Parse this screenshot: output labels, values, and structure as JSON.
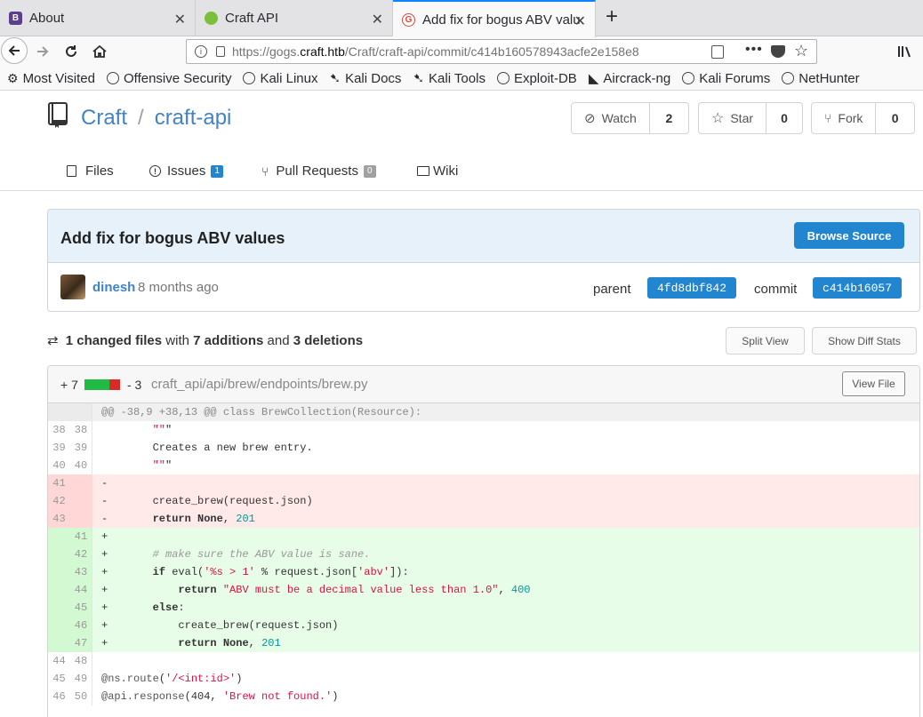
{
  "browser": {
    "tabs": [
      {
        "label": "About",
        "favicon": "B",
        "favicon_color": "#5a3f8c"
      },
      {
        "label": "Craft API",
        "favicon": "",
        "favicon_color": "#7bbf3a"
      },
      {
        "label": "Add fix for bogus ABV valu",
        "favicon": "G",
        "favicon_color": "#d9463a"
      }
    ],
    "url_prefix": "https://gogs.",
    "url_domain": "craft.htb",
    "url_suffix": "/Craft/craft-api/commit/c414b160578943acfe2e158e8",
    "bookmarks": [
      "Most Visited",
      "Offensive Security",
      "Kali Linux",
      "Kali Docs",
      "Kali Tools",
      "Exploit-DB",
      "Aircrack-ng",
      "Kali Forums",
      "NetHunter"
    ]
  },
  "repo": {
    "owner": "Craft",
    "name": "craft-api",
    "watch_label": "Watch",
    "watch_count": "2",
    "star_label": "Star",
    "star_count": "0",
    "fork_label": "Fork",
    "fork_count": "0",
    "tabs": [
      {
        "label": "Files",
        "badge": ""
      },
      {
        "label": "Issues",
        "badge": "1"
      },
      {
        "label": "Pull Requests",
        "badge": "0"
      },
      {
        "label": "Wiki",
        "badge": ""
      }
    ]
  },
  "commit": {
    "title": "Add fix for bogus ABV values",
    "browse_label": "Browse Source",
    "author": "dinesh",
    "when": "8 months ago",
    "parent_label": "parent",
    "parent_sha": "4fd8dbf842",
    "commit_label": "commit",
    "commit_sha": "c414b16057"
  },
  "stats": {
    "files": "1 changed files",
    "with": "with",
    "additions": "7 additions",
    "and": "and",
    "deletions": "3 deletions",
    "split_view": "Split View",
    "show_stats": "Show Diff Stats"
  },
  "file": {
    "additions": "+ 7",
    "deletions": "- 3",
    "path": "craft_api/api/brew/endpoints/brew.py",
    "view_file": "View File",
    "add_color": "#21ba45",
    "del_color": "#db2828"
  },
  "diff": {
    "hunk": "@@ -38,9 +38,13 @@ class BrewCollection(Resource):",
    "lines": [
      {
        "type": "ctx",
        "old": "38",
        "new": "38",
        "code": "        \"\"\""
      },
      {
        "type": "ctx",
        "old": "39",
        "new": "39",
        "code": "        Creates a new brew entry."
      },
      {
        "type": "ctx",
        "old": "40",
        "new": "40",
        "code": "        \"\"\""
      },
      {
        "type": "del",
        "old": "41",
        "new": "",
        "code": "-"
      },
      {
        "type": "del",
        "old": "42",
        "new": "",
        "code": "-       create_brew(request.json)"
      },
      {
        "type": "del",
        "old": "43",
        "new": "",
        "code": "-       return None, 201"
      },
      {
        "type": "add",
        "old": "",
        "new": "41",
        "code": "+"
      },
      {
        "type": "add",
        "old": "",
        "new": "42",
        "code": "+       # make sure the ABV value is sane."
      },
      {
        "type": "add",
        "old": "",
        "new": "43",
        "code": "+       if eval('%s > 1' % request.json['abv']):"
      },
      {
        "type": "add",
        "old": "",
        "new": "44",
        "code": "+           return \"ABV must be a decimal value less than 1.0\", 400"
      },
      {
        "type": "add",
        "old": "",
        "new": "45",
        "code": "+       else:"
      },
      {
        "type": "add",
        "old": "",
        "new": "46",
        "code": "+           create_brew(request.json)"
      },
      {
        "type": "add",
        "old": "",
        "new": "47",
        "code": "+           return None, 201"
      },
      {
        "type": "ctx",
        "old": "44",
        "new": "48",
        "code": ""
      },
      {
        "type": "ctx",
        "old": "45",
        "new": "49",
        "code": "@ns.route('/<int:id>')"
      },
      {
        "type": "ctx",
        "old": "46",
        "new": "50",
        "code": "@api.response(404, 'Brew not found.')"
      }
    ]
  }
}
